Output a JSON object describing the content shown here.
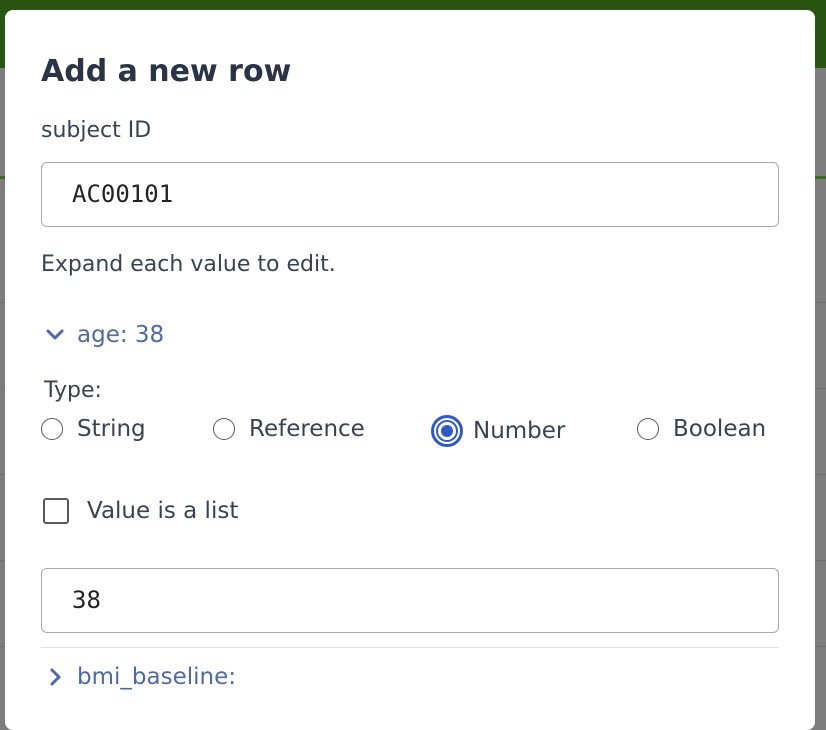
{
  "modal": {
    "title": "Add a new row",
    "subject_label": "subject ID",
    "subject_value": "AC00101",
    "helper_text": "Expand each value to edit.",
    "fields": [
      {
        "label": "age: 38",
        "expanded": true,
        "type_label": "Type:",
        "type_options": [
          "String",
          "Reference",
          "Number",
          "Boolean"
        ],
        "selected_type": "Number",
        "list_checkbox_label": "Value is a list",
        "list_checked": false,
        "value": "38"
      },
      {
        "label": "bmi_baseline:",
        "expanded": false
      }
    ]
  },
  "colors": {
    "accent": "#2f5ac4",
    "link": "#4e6aa6",
    "header_green": "#2a5412"
  },
  "icons": {
    "expanded": "chevron-down-icon",
    "collapsed": "chevron-right-icon"
  }
}
